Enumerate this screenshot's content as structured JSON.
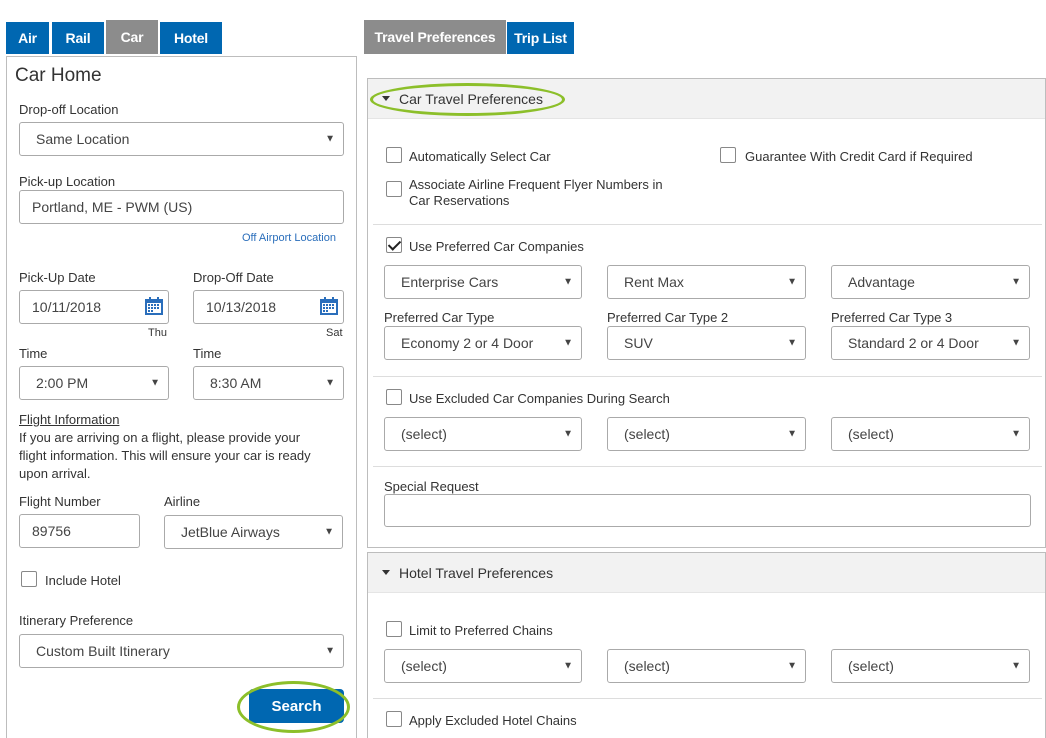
{
  "tabs": {
    "air": "Air",
    "rail": "Rail",
    "car": "Car",
    "hotel": "Hotel",
    "travel_preferences": "Travel Preferences",
    "trip_list": "Trip List"
  },
  "car_home": {
    "title": "Car Home",
    "dropoff_location_label": "Drop-off Location",
    "dropoff_location_value": "Same Location",
    "pickup_location_label": "Pick-up Location",
    "pickup_location_value": "Portland, ME - PWM (US)",
    "off_airport_link": "Off Airport Location",
    "pickup_date_label": "Pick-Up Date",
    "pickup_date_value": "10/11/2018",
    "pickup_day": "Thu",
    "dropoff_date_label": "Drop-Off Date",
    "dropoff_date_value": "10/13/2018",
    "dropoff_day": "Sat",
    "pickup_time_label": "Time",
    "pickup_time_value": "2:00 PM",
    "dropoff_time_label": "Time",
    "dropoff_time_value": "8:30 AM",
    "flight_info_heading": "Flight Information",
    "flight_info_text_1": "If you are arriving on a flight, please provide your",
    "flight_info_text_2": "flight information. This will ensure your car is ready",
    "flight_info_text_3": "upon arrival.",
    "flight_number_label": "Flight Number",
    "flight_number_value": "89756",
    "airline_label": "Airline",
    "airline_value": "JetBlue Airways",
    "include_hotel_label": "Include Hotel",
    "include_hotel_checked": false,
    "itinerary_pref_label": "Itinerary Preference",
    "itinerary_pref_value": "Custom Built Itinerary",
    "search_label": "Search"
  },
  "car_prefs": {
    "title": "Car Travel Preferences",
    "auto_select_label": "Automatically Select Car",
    "guarantee_label": "Guarantee With Credit Card if Required",
    "associate_label_1": "Associate Airline Frequent Flyer Numbers in",
    "associate_label_2": "Car Reservations",
    "use_preferred_label": "Use Preferred Car Companies",
    "use_preferred_checked": true,
    "company_1": "Enterprise Cars",
    "company_2": "Rent Max",
    "company_3": "Advantage",
    "type_1_label": "Preferred Car Type",
    "type_2_label": "Preferred Car Type 2",
    "type_3_label": "Preferred Car Type 3",
    "type_1_value": "Economy 2 or 4 Door",
    "type_2_value": "SUV",
    "type_3_value": "Standard 2 or 4 Door",
    "use_excluded_label": "Use Excluded Car Companies During Search",
    "excluded_1": "(select)",
    "excluded_2": "(select)",
    "excluded_3": "(select)",
    "special_request_label": "Special Request",
    "special_request_value": ""
  },
  "hotel_prefs": {
    "title": "Hotel Travel Preferences",
    "limit_chains_label": "Limit to Preferred Chains",
    "chain_1": "(select)",
    "chain_2": "(select)",
    "chain_3": "(select)",
    "apply_excluded_label": "Apply Excluded Hotel Chains"
  },
  "colors": {
    "tab_blue": "#0067b1",
    "tab_active_gray": "#8c8c8c",
    "highlight_ring": "#8cbf2a",
    "link_blue": "#2a6ebb"
  },
  "icons": {
    "calendar": "calendar-icon",
    "dropdown": "chevron-down-icon",
    "collapse": "triangle-down-icon"
  }
}
